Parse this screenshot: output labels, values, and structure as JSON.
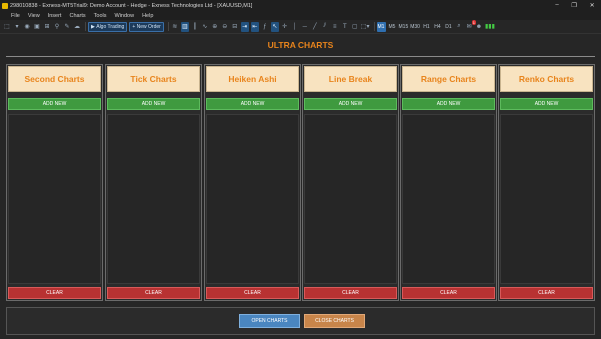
{
  "window": {
    "title": "298010838 - Exness-MT5Trial9: Demo Account - Hedge - Exness Technologies Ltd - [XAUUSD,M1]"
  },
  "menu": [
    "File",
    "View",
    "Insert",
    "Charts",
    "Tools",
    "Window",
    "Help"
  ],
  "toolbar": {
    "algo_trading_label": "Algo Trading",
    "new_order_label": "New Order",
    "timeframes": [
      "M1",
      "M5",
      "M15",
      "M30",
      "H1",
      "H4",
      "D1"
    ],
    "active_timeframe": "M1",
    "notification_badge": "1"
  },
  "panel": {
    "title": "ULTRA CHARTS",
    "columns": [
      {
        "title": "Second Charts",
        "add_label": "ADD NEW",
        "clear_label": "CLEAR"
      },
      {
        "title": "Tick Charts",
        "add_label": "ADD NEW",
        "clear_label": "CLEAR"
      },
      {
        "title": "Heiken Ashi",
        "add_label": "ADD NEW",
        "clear_label": "CLEAR"
      },
      {
        "title": "Line Break",
        "add_label": "ADD NEW",
        "clear_label": "CLEAR"
      },
      {
        "title": "Range Charts",
        "add_label": "ADD NEW",
        "clear_label": "CLEAR"
      },
      {
        "title": "Renko Charts",
        "add_label": "ADD NEW",
        "clear_label": "CLEAR"
      }
    ],
    "open_charts_label": "OPEN CHARTS",
    "close_charts_label": "CLOSE CHARTS"
  },
  "colors": {
    "accent_orange": "#e8841c",
    "header_bg": "#f8e3c0",
    "add_green": "#3f9a3f",
    "clear_red": "#b83232",
    "open_blue": "#4a86c0",
    "close_orange": "#c8854a"
  }
}
